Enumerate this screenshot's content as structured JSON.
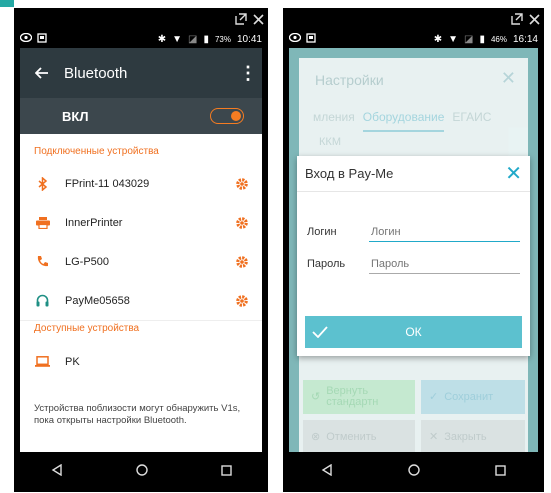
{
  "window": {
    "maximize_icon": "maximize-icon",
    "close_icon": "close-icon"
  },
  "left": {
    "status": {
      "battery": "73%",
      "time": "10:41"
    },
    "appbar": {
      "title": "Bluetooth"
    },
    "toggle": {
      "label": "ВКЛ",
      "on": true
    },
    "connected_section": "Подключенные устройства",
    "connected": [
      {
        "name": "FPrint-11 043029",
        "icon": "bluetooth-icon"
      },
      {
        "name": "InnerPrinter",
        "icon": "printer-icon"
      },
      {
        "name": "LG-P500",
        "icon": "phone-icon"
      },
      {
        "name": "PayMe05658",
        "icon": "headset-icon"
      }
    ],
    "available_section": "Доступные устройства",
    "available": [
      {
        "name": "PK",
        "icon": "laptop-icon"
      }
    ],
    "note": "Устройства поблизости могут обнаружить V1s, пока открыты настройки Bluetooth."
  },
  "right": {
    "status": {
      "battery": "46%",
      "time": "16:14"
    },
    "bg": {
      "title": "Настройки",
      "tabs": [
        "мления",
        "Оборудование",
        "ЕГАИС"
      ],
      "kkm": "ККМ",
      "btn_reset": "Вернуть стандартн",
      "btn_save": "Сохранит",
      "btn_cancel": "Отменить",
      "btn_close": "Закрыть"
    },
    "dialog": {
      "title": "Вход в Pay-Me",
      "login_label": "Логин",
      "login_placeholder": "Логин",
      "password_label": "Пароль",
      "password_placeholder": "Пароль",
      "ok_label": "ОК"
    }
  },
  "colors": {
    "accent": "#f07020",
    "teal": "#5cc1cf",
    "appbar": "#2e3a40"
  }
}
